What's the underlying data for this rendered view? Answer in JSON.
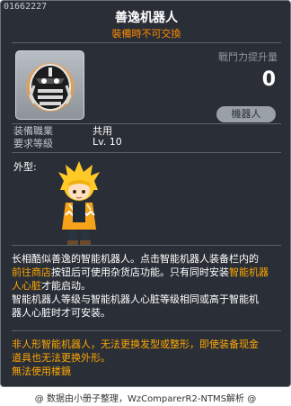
{
  "item_id": "01662227",
  "title": "善逸机器人",
  "subtitle": "裝備時不可交換",
  "power": {
    "label": "戰鬥力提升量",
    "value": "0"
  },
  "category_badge": "機器人",
  "stats": [
    {
      "label": "装備職業",
      "value": "共用"
    },
    {
      "label": "要求等級",
      "value": "Lv. 10"
    }
  ],
  "appearance_label": "外型:",
  "description": {
    "l1": "长相酷似善逸的智能机器人。点击智能机器人装备栏内的",
    "l2a": "前往商店",
    "l2b": "按钮后可使用杂货店功能。只有同时安装",
    "l2c": "智能机器",
    "l3a": "人心脏",
    "l3b": "才能启动。",
    "l4": "智能机器人等级与智能机器人心脏等级相同或高于智能机",
    "l5": "器人心脏时才可安装。"
  },
  "warning": {
    "l1": "非人形智能机器人，无法更换发型或整形，即使装备现金",
    "l2": "道具也无法更换外形。",
    "l3": "無法使用楼鏡"
  },
  "footer": "@ 数据由小册子整理，WzComparerR2-NTMS解析 @",
  "colors": {
    "background": "#2a2f37",
    "highlight": "#ffa700",
    "subtitle": "#ff8a00"
  },
  "icons": {
    "item": "robot-mask-icon",
    "avatar": "character-avatar"
  }
}
